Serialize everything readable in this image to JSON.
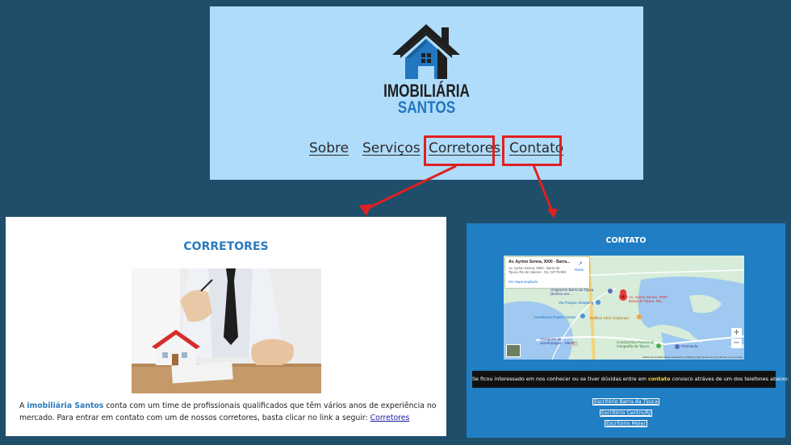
{
  "header": {
    "logo_line1": "IMOBILIÁRIA",
    "logo_line2": "SANTOS",
    "nav": [
      "Sobre",
      "Serviços",
      "Corretores",
      "Contato"
    ]
  },
  "corretores": {
    "title": "CORRETORES",
    "text_prefix": "A ",
    "brand": "imobiliária Santos",
    "text_middle": " conta com um time de profissionais qualificados que têm vários anos de experiência no mercado. Para entrar em contato com um de nossos corretores, basta clicar no link a seguir: ",
    "link": "Corretores"
  },
  "contato": {
    "title": "CONTATO",
    "map": {
      "card_title": "Av. Ayrton Senna, 3000 - Barra...",
      "card_address": "Av. Ayrton Senna, 3000 - Barra da Tijuca, Rio de Janeiro - RJ, 22775-904",
      "card_link": "Ver mapa ampliado",
      "card_route": "Rotas",
      "pin_label": "Av. Ayrton Senna, 3000 Barra da Tijuca, Rio...",
      "labels": [
        "Unigranrio Barra da Tijuca (Ensino em...",
        "Via Parque Shopping",
        "Aeroletown Power Center",
        "Edifício CEO Corporate",
        "Aeroporto de Jacarepaguá - SBJR",
        "Condomínio Península Geografia da Tijuca",
        "Península"
      ],
      "footer": "Atalhos do teclado   Dados cartográficos ©2022 Google   Termos de Uso   Informar erro no mapa"
    },
    "bar_prefix": "Se ficou interessado em nos conhecer ou se tiver dúvidas entre em ",
    "bar_highlight": "contato",
    "bar_suffix": " conosco atráves de um dos telefones abaixo:",
    "offices": [
      "Escritório Barra da Tijuca",
      "Escritório Centro/RJ",
      "Escritório Méier"
    ]
  },
  "colors": {
    "background": "#1f4e6b",
    "header_bg": "#afdcfb",
    "accent_blue": "#2b7bbd",
    "highlight_red": "#e02020",
    "contato_bg": "#1f7ec4"
  }
}
